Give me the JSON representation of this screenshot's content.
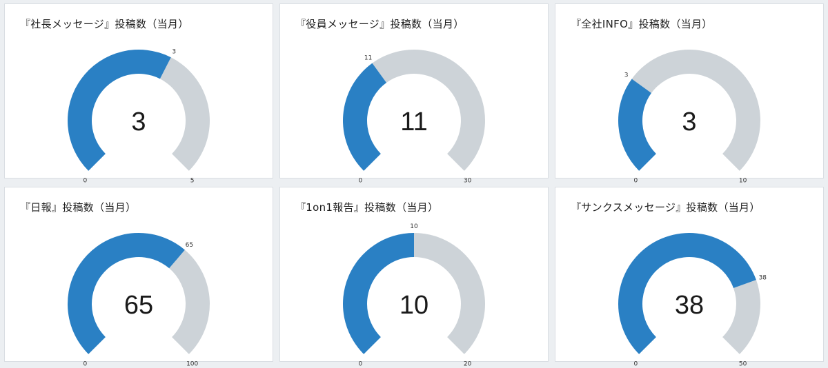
{
  "colors": {
    "filled": "#2a80c4",
    "remaining": "#cdd3d8",
    "background": "#eceff2",
    "card": "#ffffff"
  },
  "chart_data": [
    {
      "type": "gauge",
      "title": "『社長メッセージ』投稿数（当月）",
      "value": 3,
      "min": 0,
      "max": 5,
      "value_label": "3",
      "min_label": "0",
      "max_label": "5"
    },
    {
      "type": "gauge",
      "title": "『役員メッセージ』投稿数（当月）",
      "value": 11,
      "min": 0,
      "max": 30,
      "value_label": "11",
      "min_label": "0",
      "max_label": "30"
    },
    {
      "type": "gauge",
      "title": "『全社INFO』投稿数（当月）",
      "value": 3,
      "min": 0,
      "max": 10,
      "value_label": "3",
      "min_label": "0",
      "max_label": "10"
    },
    {
      "type": "gauge",
      "title": "『日報』投稿数（当月）",
      "value": 65,
      "min": 0,
      "max": 100,
      "value_label": "65",
      "min_label": "0",
      "max_label": "100"
    },
    {
      "type": "gauge",
      "title": "『1on1報告』投稿数（当月）",
      "value": 10,
      "min": 0,
      "max": 20,
      "value_label": "10",
      "min_label": "0",
      "max_label": "20"
    },
    {
      "type": "gauge",
      "title": "『サンクスメッセージ』投稿数（当月）",
      "value": 38,
      "min": 0,
      "max": 50,
      "value_label": "38",
      "min_label": "0",
      "max_label": "50"
    }
  ]
}
